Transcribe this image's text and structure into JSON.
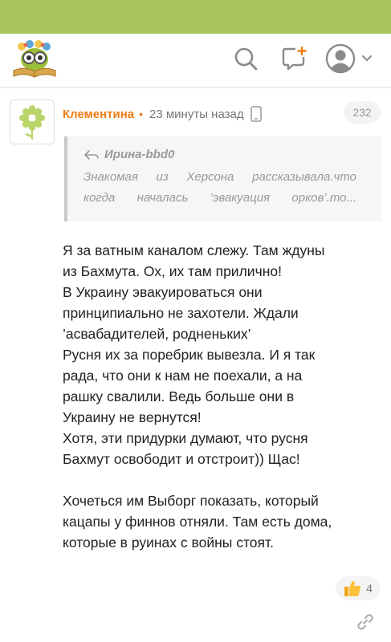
{
  "header": {
    "logo_icon": "owl-with-book-logo",
    "search_icon": "search-icon",
    "notify_icon": "chat-plus-icon",
    "profile_icon": "user-avatar-icon",
    "accent": "#a7c35b"
  },
  "comment": {
    "avatar_icon": "flower-icon",
    "author": "Клементина",
    "separator": "•",
    "time": "23 минуты назад",
    "device_icon": "mobile-phone-icon",
    "number": "232",
    "author_color": "#ef7b12",
    "quote": {
      "author": "Ирина-bbd0",
      "line1": "Знакомая из Херсона рассказывала.что",
      "line2": "когда началась ’эвакуация орков’.то..."
    },
    "paragraph1": [
      "Я за ватным каналом слежу. Там ждуны",
      "из Бахмута. Ох, их там прилично!",
      "В Украину эвакуироваться они",
      "принципиально не захотели. Ждали",
      "’асвабадителей, родненьких’",
      "Русня их за поребрик вывезла. И я так",
      "рада, что они к нам не поехали, а на",
      "рашку свалили. Ведь больше они в",
      "Украину не вернутся!",
      "Хотя, эти придурки думают, что русня",
      "Бахмут освободит и отстроит)) Щас!"
    ],
    "paragraph2": [
      "Хочеться им Выборг показать, который",
      "кацапы у финнов отняли. Там есть дома,",
      "которые в руинах с войны стоят."
    ],
    "likes": "4",
    "like_icon": "thumbs-up-icon",
    "link_icon": "link-icon"
  }
}
